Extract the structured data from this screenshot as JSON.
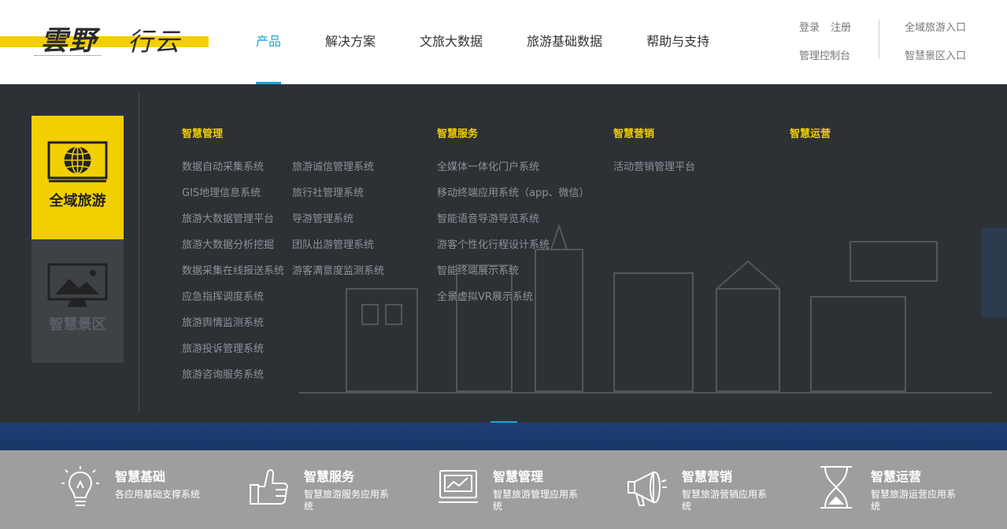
{
  "logo": {
    "word1": "雲野",
    "word2": "行云"
  },
  "nav": {
    "items": [
      {
        "label": "产品",
        "active": true
      },
      {
        "label": "解决方案",
        "active": false
      },
      {
        "label": "文旅大数据",
        "active": false
      },
      {
        "label": "旅游基础数据",
        "active": false
      },
      {
        "label": "帮助与支持",
        "active": false
      }
    ]
  },
  "header_links": {
    "login": "登录",
    "register": "注册",
    "console": "管理控制台",
    "global_entry": "全域旅游入口",
    "scenic_entry": "智慧景区入口"
  },
  "dropdown": {
    "tabs": [
      {
        "label": "全域旅游",
        "icon": "globe-icon"
      },
      {
        "label": "智慧景区",
        "icon": "landscape-monitor-icon"
      }
    ],
    "columns": {
      "management": {
        "title": "智慧管理",
        "col1": [
          "数据自动采集系统",
          "GIS地理信息系统",
          "旅游大数据管理平台",
          "旅游大数据分析挖掘",
          "数据采集在线报送系统",
          "应急指挥调度系统",
          "旅游舆情监测系统",
          "旅游投诉管理系统",
          "旅游咨询服务系统"
        ],
        "col2": [
          "旅游诚信管理系统",
          "旅行社管理系统",
          "导游管理系统",
          "团队出游管理系统",
          "游客满意度监测系统"
        ]
      },
      "service": {
        "title": "智慧服务",
        "items": [
          "全媒体一体化门户系统",
          "移动终端应用系统（app、微信）",
          "智能语音导游导览系统",
          "游客个性化行程设计系统",
          "智能终端展示系统",
          "全景虚拟VR展示系统"
        ]
      },
      "marketing": {
        "title": "智慧营销",
        "items": [
          "活动营销管理平台"
        ]
      },
      "operation": {
        "title": "智慧运营",
        "items": []
      }
    }
  },
  "features": [
    {
      "title": "智慧基础",
      "desc": "各应用基础支撑系统",
      "icon": "lightbulb-icon"
    },
    {
      "title": "智慧服务",
      "desc": "智慧旅游服务应用系统",
      "icon": "thumbs-up-icon"
    },
    {
      "title": "智慧管理",
      "desc": "智慧旅游管理应用系统",
      "icon": "monitor-chart-icon"
    },
    {
      "title": "智慧营销",
      "desc": "智慧旅游营销应用系统",
      "icon": "megaphone-icon"
    },
    {
      "title": "智慧运营",
      "desc": "智慧旅游运营应用系统",
      "icon": "hourglass-icon"
    }
  ],
  "colors": {
    "accent_yellow": "#f2cf00",
    "accent_blue": "#1aa3d6",
    "panel_bg": "#2d3136",
    "footer_bg": "#9e9e9e"
  }
}
